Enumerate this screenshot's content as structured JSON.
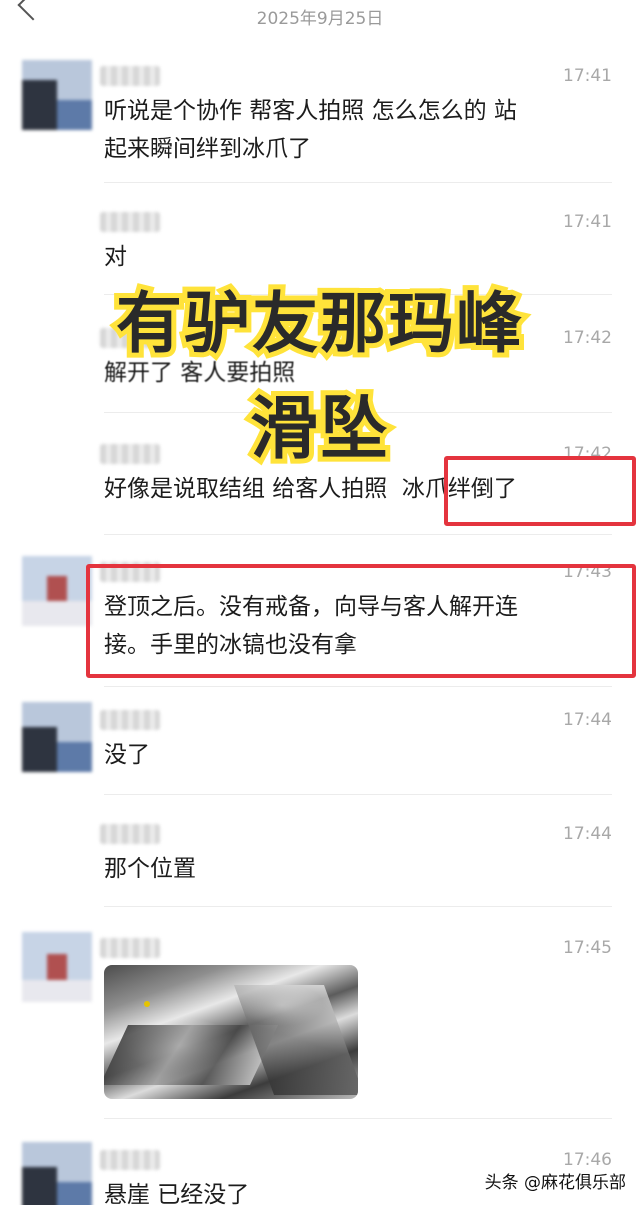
{
  "date_header": "2025年9月25日",
  "overlay": {
    "line1": "有驴友那玛峰",
    "line2": "滑坠"
  },
  "messages": [
    {
      "time": "17:41",
      "text": "听说是个协作 帮客人拍照 怎么怎么的 站\n起来瞬间绊到冰爪了"
    },
    {
      "time": "17:41",
      "text": "对"
    },
    {
      "time": "17:42",
      "text": "解开了 客人要拍照"
    },
    {
      "time": "17:42",
      "text": "好像是说取结组 给客人拍照  冰爪绊倒了"
    },
    {
      "time": "17:43",
      "text": "登顶之后。没有戒备，向导与客人解开连\n接。手里的冰镐也没有拿"
    },
    {
      "time": "17:44",
      "text": "没了"
    },
    {
      "time": "17:44",
      "text": "那个位置"
    },
    {
      "time": "17:45",
      "text": ""
    },
    {
      "time": "17:46",
      "text": "悬崖 已经没了"
    }
  ],
  "watermark": "头条 @麻花俱乐部",
  "colors": {
    "highlight_border": "#e4343e",
    "overlay_stroke": "#ffe33a",
    "time_text": "#a8a8a8"
  },
  "icons": {
    "back": "back-arrow-icon"
  }
}
